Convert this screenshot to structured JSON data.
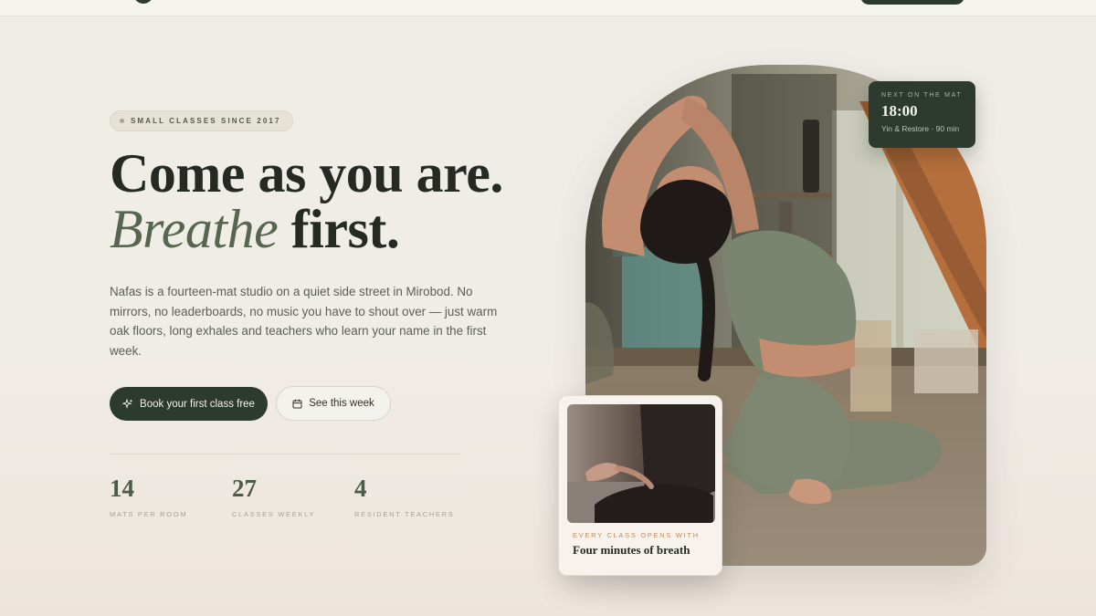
{
  "hero": {
    "badge": "SMALL CLASSES SINCE 2017",
    "headline_line1": "Come as you are.",
    "headline_italic": "Breathe",
    "headline_end": " first.",
    "intro": "Nafas is a fourteen-mat studio on a quiet side street in Mirobod. No mirrors, no leaderboards, no music you have to shout over — just warm oak floors, long exhales and teachers who learn your name in the first week.",
    "primary_cta": "Book your first class free",
    "secondary_cta": "See this week"
  },
  "stats": [
    {
      "value": "14",
      "label": "MATS PER ROOM"
    },
    {
      "value": "27",
      "label": "CLASSES WEEKLY"
    },
    {
      "value": "4",
      "label": "RESIDENT TEACHERS"
    }
  ],
  "next_class": {
    "kicker": "NEXT ON THE MAT",
    "time": "18:00",
    "details": "Yin & Restore · 90 min"
  },
  "polaroid": {
    "kicker": "EVERY CLASS OPENS WITH",
    "title": "Four minutes of breath"
  },
  "icons": {
    "primary_cta": "sparkle-icon",
    "secondary_cta": "calendar-icon"
  },
  "colors": {
    "accent_dark_green": "#2c3a30",
    "sage": "#56664f",
    "terracotta": "#c08a63",
    "background": "#efece6"
  }
}
